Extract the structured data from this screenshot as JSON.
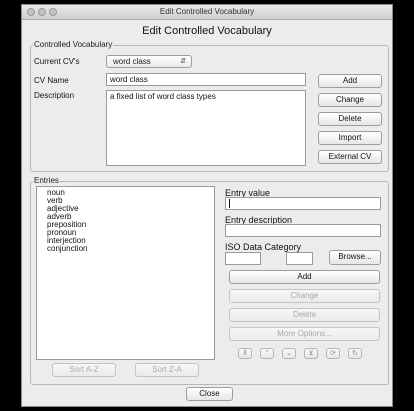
{
  "window": {
    "title": "Edit Controlled Vocabulary"
  },
  "heading": "Edit Controlled Vocabulary",
  "cv_group": {
    "legend": "Controlled Vocabulary",
    "current_label": "Current CV's",
    "current_value": "word class",
    "name_label": "CV Name",
    "name_value": "word class",
    "description_label": "Description",
    "description_value": "a fixed list of word class types",
    "buttons": {
      "add": "Add",
      "change": "Change",
      "delete": "Delete",
      "import": "Import",
      "external": "External CV"
    }
  },
  "entries_group": {
    "legend": "Entries",
    "items": [
      "noun",
      "verb",
      "adjective",
      "adverb",
      "preposition",
      "pronoun",
      "interjection",
      "conjunction"
    ],
    "entry_value_label": "Entry value",
    "entry_value": "",
    "entry_description_label": "Entry description",
    "entry_description": "",
    "iso_label": "ISO Data Category",
    "iso_value_1": "",
    "iso_value_2": "",
    "buttons": {
      "browse": "Browse...",
      "add": "Add",
      "change": "Change",
      "delete": "Delete",
      "more_options": "More Options...",
      "sort_az": "Sort A-Z",
      "sort_za": "Sort Z-A"
    },
    "nav_icons": [
      "move-to-top-icon",
      "move-up-icon",
      "move-down-icon",
      "move-to-bottom-icon",
      "rotate-icon",
      "refresh-icon"
    ]
  },
  "footer": {
    "close": "Close"
  }
}
